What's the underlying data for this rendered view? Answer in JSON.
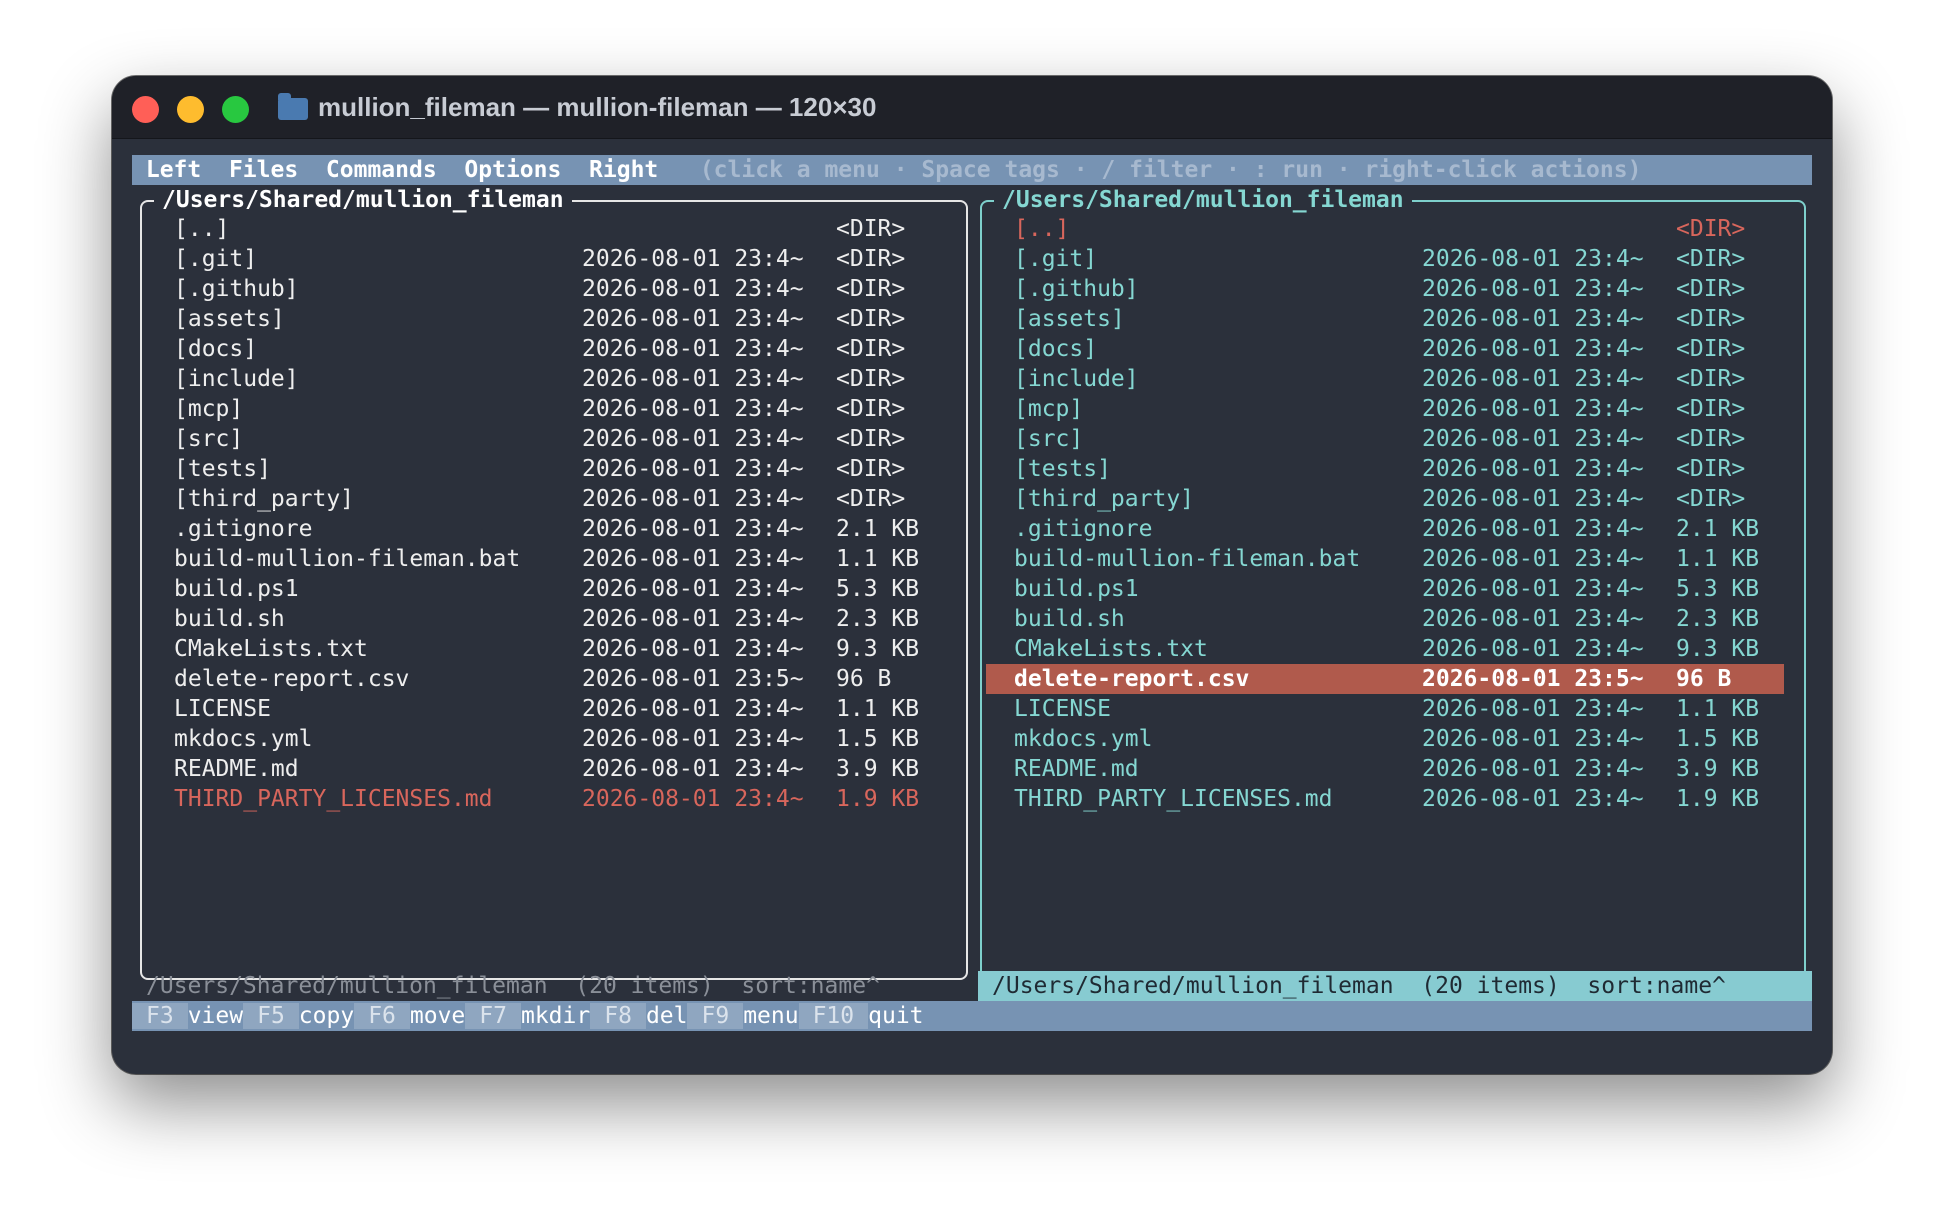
{
  "window": {
    "title": "mullion_fileman — mullion-fileman — 120×30",
    "icon": "folder-icon"
  },
  "menubar": {
    "items": [
      "Left",
      "Files",
      "Commands",
      "Options",
      "Right"
    ],
    "hint": "(click a menu · Space tags · / filter · : run · right-click actions)"
  },
  "left_panel": {
    "path": "/Users/Shared/mullion_fileman",
    "files": [
      {
        "name": "[..]",
        "date": "",
        "size": "<DIR>"
      },
      {
        "name": "[.git]",
        "date": "2026-08-01 23:4~",
        "size": "<DIR>"
      },
      {
        "name": "[.github]",
        "date": "2026-08-01 23:4~",
        "size": "<DIR>"
      },
      {
        "name": "[assets]",
        "date": "2026-08-01 23:4~",
        "size": "<DIR>"
      },
      {
        "name": "[docs]",
        "date": "2026-08-01 23:4~",
        "size": "<DIR>"
      },
      {
        "name": "[include]",
        "date": "2026-08-01 23:4~",
        "size": "<DIR>"
      },
      {
        "name": "[mcp]",
        "date": "2026-08-01 23:4~",
        "size": "<DIR>"
      },
      {
        "name": "[src]",
        "date": "2026-08-01 23:4~",
        "size": "<DIR>"
      },
      {
        "name": "[tests]",
        "date": "2026-08-01 23:4~",
        "size": "<DIR>"
      },
      {
        "name": "[third_party]",
        "date": "2026-08-01 23:4~",
        "size": "<DIR>"
      },
      {
        "name": ".gitignore",
        "date": "2026-08-01 23:4~",
        "size": "2.1 KB"
      },
      {
        "name": "build-mullion-fileman.bat",
        "date": "2026-08-01 23:4~",
        "size": "1.1 KB"
      },
      {
        "name": "build.ps1",
        "date": "2026-08-01 23:4~",
        "size": "5.3 KB"
      },
      {
        "name": "build.sh",
        "date": "2026-08-01 23:4~",
        "size": "2.3 KB"
      },
      {
        "name": "CMakeLists.txt",
        "date": "2026-08-01 23:4~",
        "size": "9.3 KB"
      },
      {
        "name": "delete-report.csv",
        "date": "2026-08-01 23:5~",
        "size": "96 B"
      },
      {
        "name": "LICENSE",
        "date": "2026-08-01 23:4~",
        "size": "1.1 KB"
      },
      {
        "name": "mkdocs.yml",
        "date": "2026-08-01 23:4~",
        "size": "1.5 KB"
      },
      {
        "name": "README.md",
        "date": "2026-08-01 23:4~",
        "size": "3.9 KB"
      },
      {
        "name": "THIRD_PARTY_LICENSES.md",
        "date": "2026-08-01 23:4~",
        "size": "1.9 KB",
        "state": "marked"
      }
    ],
    "status": "/Users/Shared/mullion_fileman  (20 items)  sort:name^"
  },
  "right_panel": {
    "path": "/Users/Shared/mullion_fileman",
    "files": [
      {
        "name": "[..]",
        "date": "",
        "size": "<DIR>",
        "state": "marked"
      },
      {
        "name": "[.git]",
        "date": "2026-08-01 23:4~",
        "size": "<DIR>"
      },
      {
        "name": "[.github]",
        "date": "2026-08-01 23:4~",
        "size": "<DIR>"
      },
      {
        "name": "[assets]",
        "date": "2026-08-01 23:4~",
        "size": "<DIR>"
      },
      {
        "name": "[docs]",
        "date": "2026-08-01 23:4~",
        "size": "<DIR>"
      },
      {
        "name": "[include]",
        "date": "2026-08-01 23:4~",
        "size": "<DIR>"
      },
      {
        "name": "[mcp]",
        "date": "2026-08-01 23:4~",
        "size": "<DIR>"
      },
      {
        "name": "[src]",
        "date": "2026-08-01 23:4~",
        "size": "<DIR>"
      },
      {
        "name": "[tests]",
        "date": "2026-08-01 23:4~",
        "size": "<DIR>"
      },
      {
        "name": "[third_party]",
        "date": "2026-08-01 23:4~",
        "size": "<DIR>"
      },
      {
        "name": ".gitignore",
        "date": "2026-08-01 23:4~",
        "size": "2.1 KB"
      },
      {
        "name": "build-mullion-fileman.bat",
        "date": "2026-08-01 23:4~",
        "size": "1.1 KB"
      },
      {
        "name": "build.ps1",
        "date": "2026-08-01 23:4~",
        "size": "5.3 KB"
      },
      {
        "name": "build.sh",
        "date": "2026-08-01 23:4~",
        "size": "2.3 KB"
      },
      {
        "name": "CMakeLists.txt",
        "date": "2026-08-01 23:4~",
        "size": "9.3 KB"
      },
      {
        "name": "delete-report.csv",
        "date": "2026-08-01 23:5~",
        "size": "96 B",
        "state": "cursor"
      },
      {
        "name": "LICENSE",
        "date": "2026-08-01 23:4~",
        "size": "1.1 KB"
      },
      {
        "name": "mkdocs.yml",
        "date": "2026-08-01 23:4~",
        "size": "1.5 KB"
      },
      {
        "name": "README.md",
        "date": "2026-08-01 23:4~",
        "size": "3.9 KB"
      },
      {
        "name": "THIRD_PARTY_LICENSES.md",
        "date": "2026-08-01 23:4~",
        "size": "1.9 KB"
      }
    ],
    "status": "/Users/Shared/mullion_fileman  (20 items)  sort:name^"
  },
  "fkeys": [
    {
      "key": "F3",
      "label": "view"
    },
    {
      "key": "F5",
      "label": "copy"
    },
    {
      "key": "F6",
      "label": "move"
    },
    {
      "key": "F7",
      "label": "mkdir"
    },
    {
      "key": "F8",
      "label": "del"
    },
    {
      "key": "F9",
      "label": "menu"
    },
    {
      "key": "F10",
      "label": "quit"
    }
  ],
  "colors": {
    "menubar_bg": "#7793b3",
    "terminal_bg": "#2b303b",
    "active_panel": "#85d7d2",
    "cursor_bg": "#b05a4c",
    "marked": "#d8665c"
  }
}
